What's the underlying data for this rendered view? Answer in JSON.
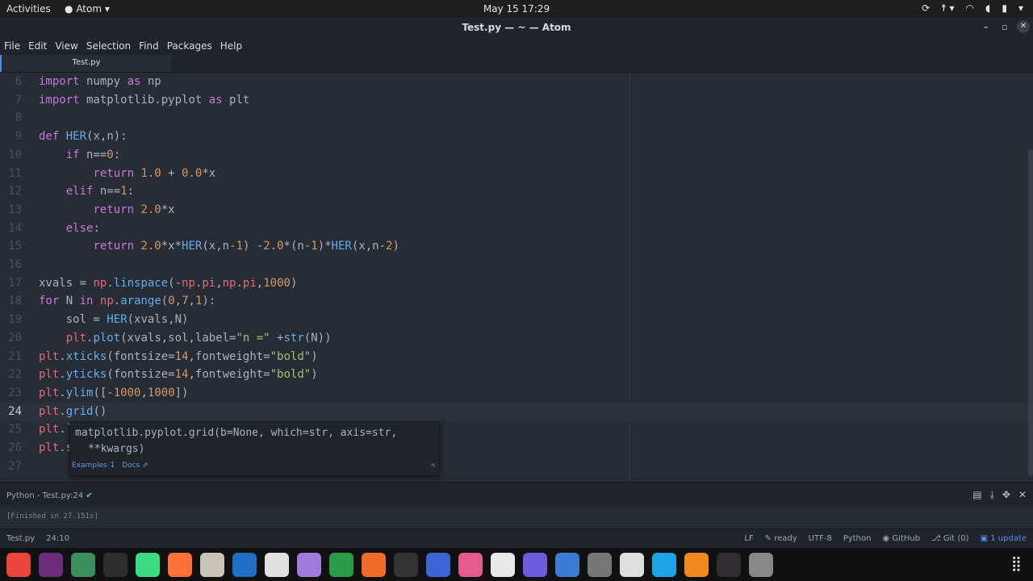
{
  "topbar": {
    "activities": "Activities",
    "app_name": "Atom",
    "clock": "May 15  17:29"
  },
  "window": {
    "title": "Test.py — ~ — Atom"
  },
  "menu": [
    "File",
    "Edit",
    "View",
    "Selection",
    "Find",
    "Packages",
    "Help"
  ],
  "tab": {
    "label": "Test.py"
  },
  "editor": {
    "line_numbers": [
      "6",
      "7",
      "8",
      "9",
      "10",
      "11",
      "12",
      "13",
      "14",
      "15",
      "16",
      "17",
      "18",
      "19",
      "20",
      "21",
      "22",
      "23",
      "24",
      "25",
      "26",
      "27"
    ],
    "current_line": "24",
    "lines": {
      "l6": [
        "import",
        " numpy ",
        "as",
        " np"
      ],
      "l7": [
        "import",
        " matplotlib.pyplot ",
        "as",
        " plt"
      ],
      "l9": [
        "def",
        " ",
        "HER",
        "(x,n):"
      ],
      "l10": [
        "    ",
        "if",
        " n==",
        "0",
        ":"
      ],
      "l11": [
        "        ",
        "return",
        " ",
        "1.0",
        " + ",
        "0.0",
        "*x"
      ],
      "l12": [
        "    ",
        "elif",
        " n==",
        "1",
        ":"
      ],
      "l13": [
        "        ",
        "return",
        " ",
        "2.0",
        "*x"
      ],
      "l14": [
        "    ",
        "else",
        ":"
      ],
      "l15": [
        "        ",
        "return",
        " ",
        "2.0",
        "*x*",
        "HER",
        "(x,n-",
        "1",
        ") -",
        "2.0",
        "*(n-",
        "1",
        ")*",
        "HER",
        "(x,n-",
        "2",
        ")"
      ],
      "l17": [
        "xvals = ",
        "np",
        ".",
        "linspace",
        "(-",
        "np",
        ".",
        "pi",
        ",",
        "np",
        ".",
        "pi",
        ",",
        "1000",
        ")"
      ],
      "l18": [
        "for",
        " N ",
        "in",
        " ",
        "np",
        ".",
        "arange",
        "(",
        "0",
        ",",
        "7",
        ",",
        "1",
        "):"
      ],
      "l19": [
        "    sol = ",
        "HER",
        "(xvals,N)"
      ],
      "l20": [
        "    ",
        "plt",
        ".",
        "plot",
        "(xvals,sol,label=",
        "\"n =\"",
        " +",
        "str",
        "(N))"
      ],
      "l21": [
        "plt",
        ".",
        "xticks",
        "(fontsize=",
        "14",
        ",fontweight=",
        "\"bold\"",
        ")"
      ],
      "l22": [
        "plt",
        ".",
        "yticks",
        "(fontsize=",
        "14",
        ",fontweight=",
        "\"bold\"",
        ")"
      ],
      "l23": [
        "plt",
        ".",
        "ylim",
        "([-",
        "1000",
        ",",
        "1000",
        "])"
      ],
      "l24": [
        "plt",
        ".",
        "grid",
        "()"
      ],
      "l25": [
        "plt",
        ".",
        "`"
      ],
      "l26": [
        "plt",
        ".",
        "s"
      ]
    }
  },
  "autocomplete": {
    "signature": "matplotlib.pyplot.grid(b=None, which=str, axis=str,",
    "signature2": "**kwargs)",
    "examples": "Examples ↧",
    "docs": "Docs ⇗",
    "pin": "⇱"
  },
  "panel": {
    "title": "Python - Test.py:24",
    "output": "[Finished in 27.151s]"
  },
  "status": {
    "file": "Test.py",
    "cursor": "24:10",
    "line_ending": "LF",
    "ready": "ready",
    "encoding": "UTF-8",
    "grammar": "Python",
    "github": "GitHub",
    "git": "Git (0)",
    "updates": "1 update"
  },
  "colors": {
    "keyword": "#c678dd",
    "function": "#61afef",
    "number": "#d19a66",
    "string": "#98c379",
    "module": "#e06c75",
    "accent": "#568af2"
  },
  "dock": [
    {
      "icon": "chrome-icon",
      "color": "#e8453c"
    },
    {
      "icon": "texmaker-icon",
      "color": "#6b2c7a"
    },
    {
      "icon": "atom-icon",
      "color": "#3a8f5a"
    },
    {
      "icon": "terminal-icon",
      "color": "#2e2e2e"
    },
    {
      "icon": "android-studio-icon",
      "color": "#3ddc84"
    },
    {
      "icon": "firefox-icon",
      "color": "#ff7139"
    },
    {
      "icon": "files-icon",
      "color": "#c9c3b8"
    },
    {
      "icon": "writer-icon",
      "color": "#1f6fc7"
    },
    {
      "icon": "monitor-icon",
      "color": "#e0e0e0"
    },
    {
      "icon": "settings-toggle-icon",
      "color": "#a07ad9"
    },
    {
      "icon": "spreadsheet-icon",
      "color": "#2c9b46"
    },
    {
      "icon": "store-icon",
      "color": "#f06a2a"
    },
    {
      "icon": "activity-icon",
      "color": "#333"
    },
    {
      "icon": "screenshot-icon",
      "color": "#3c64d6"
    },
    {
      "icon": "color-picker-icon",
      "color": "#e55a8c"
    },
    {
      "icon": "chat-icon",
      "color": "#e8e8e8"
    },
    {
      "icon": "camera-icon",
      "color": "#6e5bd9"
    },
    {
      "icon": "pen-icon",
      "color": "#3a7bd5"
    },
    {
      "icon": "gear-icon",
      "color": "#777"
    },
    {
      "icon": "calculator-icon",
      "color": "#ddd"
    },
    {
      "icon": "app-icon",
      "color": "#1ea3e8"
    },
    {
      "icon": "vlc-icon",
      "color": "#f08a1c"
    },
    {
      "icon": "obs-icon",
      "color": "#302e31"
    },
    {
      "icon": "disk-icon",
      "color": "#888"
    }
  ]
}
